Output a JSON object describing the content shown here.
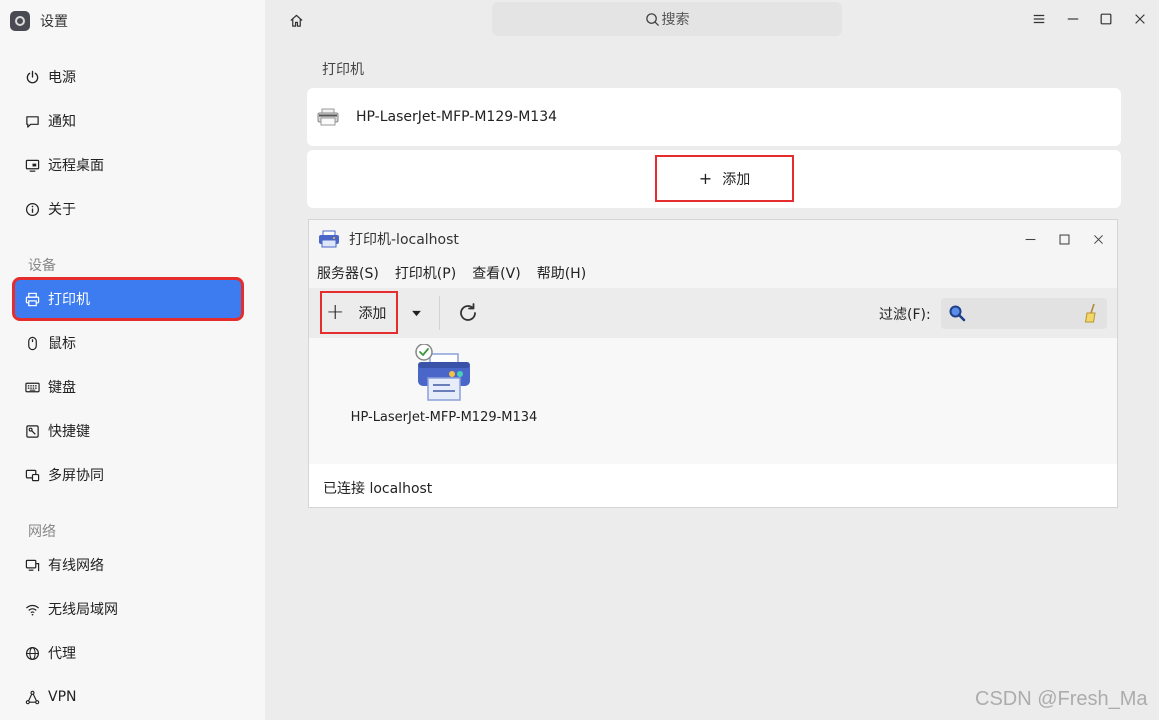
{
  "app": {
    "title": "设置"
  },
  "search": {
    "label": "搜索"
  },
  "sidebar": {
    "items": [
      {
        "label": "电源",
        "icon": "power-icon"
      },
      {
        "label": "通知",
        "icon": "message-icon"
      },
      {
        "label": "远程桌面",
        "icon": "remote-desktop-icon"
      },
      {
        "label": "关于",
        "icon": "info-icon"
      },
      {
        "label": "打印机",
        "icon": "printer-icon",
        "active": true
      },
      {
        "label": "鼠标",
        "icon": "mouse-icon"
      },
      {
        "label": "键盘",
        "icon": "keyboard-icon"
      },
      {
        "label": "快捷键",
        "icon": "shortcut-icon"
      },
      {
        "label": "多屏协同",
        "icon": "multiscreen-icon"
      },
      {
        "label": "有线网络",
        "icon": "wired-network-icon"
      },
      {
        "label": "无线局域网",
        "icon": "wifi-icon"
      },
      {
        "label": "代理",
        "icon": "proxy-icon"
      },
      {
        "label": "VPN",
        "icon": "vpn-icon"
      }
    ],
    "sections": {
      "devices": "设备",
      "network": "网络"
    }
  },
  "printers": {
    "title": "打印机",
    "list": [
      {
        "name": "HP-LaserJet-MFP-M129-M134"
      }
    ],
    "add_label": "添加"
  },
  "dialog": {
    "title": "打印机-localhost",
    "menu": [
      "服务器(S)",
      "打印机(P)",
      "查看(V)",
      "帮助(H)"
    ],
    "toolbar": {
      "add_label": "添加",
      "filter_label": "过滤(F):"
    },
    "printers": [
      {
        "name": "HP-LaserJet-MFP-M129-M134",
        "status": "default-check"
      }
    ],
    "status": "已连接 localhost"
  },
  "watermark": "CSDN @Fresh_Ma",
  "colors": {
    "accent": "#3d7cf0",
    "highlight_box": "#e52d2d"
  }
}
